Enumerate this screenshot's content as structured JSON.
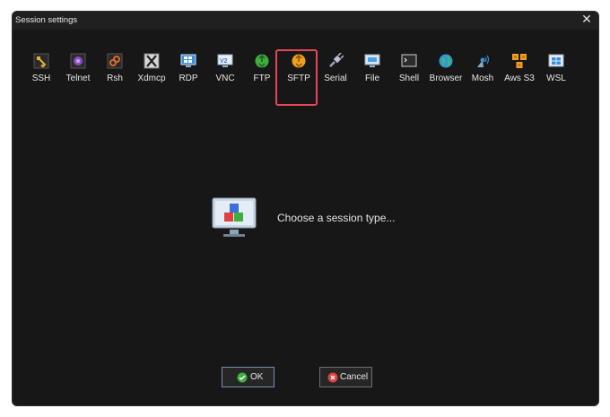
{
  "window": {
    "title": "Session settings",
    "close_icon": "close-icon"
  },
  "session_types": [
    {
      "label": "SSH",
      "icon": "ssh-key-icon",
      "color": "#e8b33a"
    },
    {
      "label": "Telnet",
      "icon": "telnet-icon",
      "color": "#8a4fc4"
    },
    {
      "label": "Rsh",
      "icon": "rsh-icon",
      "color": "#c65a2a"
    },
    {
      "label": "Xdmcp",
      "icon": "xdmcp-icon",
      "color": "#9a9a9a"
    },
    {
      "label": "RDP",
      "icon": "rdp-icon",
      "color": "#3a8fd8"
    },
    {
      "label": "VNC",
      "icon": "vnc-icon",
      "color": "#3b7fd0"
    },
    {
      "label": "FTP",
      "icon": "ftp-icon",
      "color": "#3fae3f"
    },
    {
      "label": "SFTP",
      "icon": "sftp-icon",
      "color": "#f0a020"
    },
    {
      "label": "Serial",
      "icon": "serial-plug-icon",
      "color": "#9aa5b5"
    },
    {
      "label": "File",
      "icon": "file-icon",
      "color": "#4aa0e0"
    },
    {
      "label": "Shell",
      "icon": "shell-icon",
      "color": "#3a3a3a"
    },
    {
      "label": "Browser",
      "icon": "globe-icon",
      "color": "#2f9ad8"
    },
    {
      "label": "Mosh",
      "icon": "mosh-antenna-icon",
      "color": "#3a8fd8"
    },
    {
      "label": "Aws S3",
      "icon": "aws-s3-icon",
      "color": "#f0a020"
    },
    {
      "label": "WSL",
      "icon": "windows-icon",
      "color": "#3a8fd8"
    }
  ],
  "selected": "SFTP",
  "center": {
    "message": "Choose a session type...",
    "icon": "monitor-cubes-icon"
  },
  "buttons": {
    "ok_label": "OK",
    "cancel_label": "Cancel"
  },
  "colors": {
    "background": "#171717",
    "highlight": "#e8455a",
    "ok_border": "#7b8ab0"
  }
}
